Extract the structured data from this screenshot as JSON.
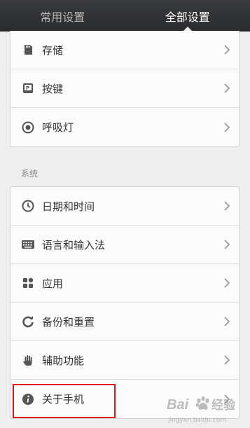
{
  "tabs": [
    {
      "label": "常用设置",
      "active": false
    },
    {
      "label": "全部设置",
      "active": true
    }
  ],
  "group1": {
    "items": [
      {
        "label": "存储",
        "icon": "storage-icon"
      },
      {
        "label": "按键",
        "icon": "key-icon"
      },
      {
        "label": "呼吸灯",
        "icon": "breathing-light-icon"
      }
    ]
  },
  "section_system": {
    "title": "系统"
  },
  "group2": {
    "items": [
      {
        "label": "日期和时间",
        "icon": "clock-icon"
      },
      {
        "label": "语言和输入法",
        "icon": "keyboard-icon"
      },
      {
        "label": "应用",
        "icon": "apps-icon"
      },
      {
        "label": "备份和重置",
        "icon": "backup-icon"
      },
      {
        "label": "辅助功能",
        "icon": "hand-icon"
      },
      {
        "label": "关于手机",
        "icon": "info-icon"
      }
    ]
  },
  "colors": {
    "highlight_box": "#e0161b",
    "tabbar": "#2f3032",
    "active_tab_text": "#ffffff"
  }
}
